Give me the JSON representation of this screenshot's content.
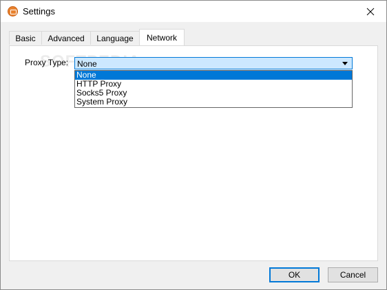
{
  "window": {
    "title": "Settings"
  },
  "tabs": [
    {
      "label": "Basic",
      "active": false
    },
    {
      "label": "Advanced",
      "active": false
    },
    {
      "label": "Language",
      "active": false
    },
    {
      "label": "Network",
      "active": true
    }
  ],
  "network": {
    "proxy_label": "Proxy Type:",
    "proxy_value": "None",
    "options": [
      "None",
      "HTTP Proxy",
      "Socks5 Proxy",
      "System Proxy"
    ],
    "selected_option": "None"
  },
  "watermark": "SOFTPEDIA",
  "buttons": {
    "ok": "OK",
    "cancel": "Cancel"
  },
  "colors": {
    "accent": "#0078d7",
    "combo_highlight": "#cce8ff",
    "app_icon": "#e9822e"
  }
}
